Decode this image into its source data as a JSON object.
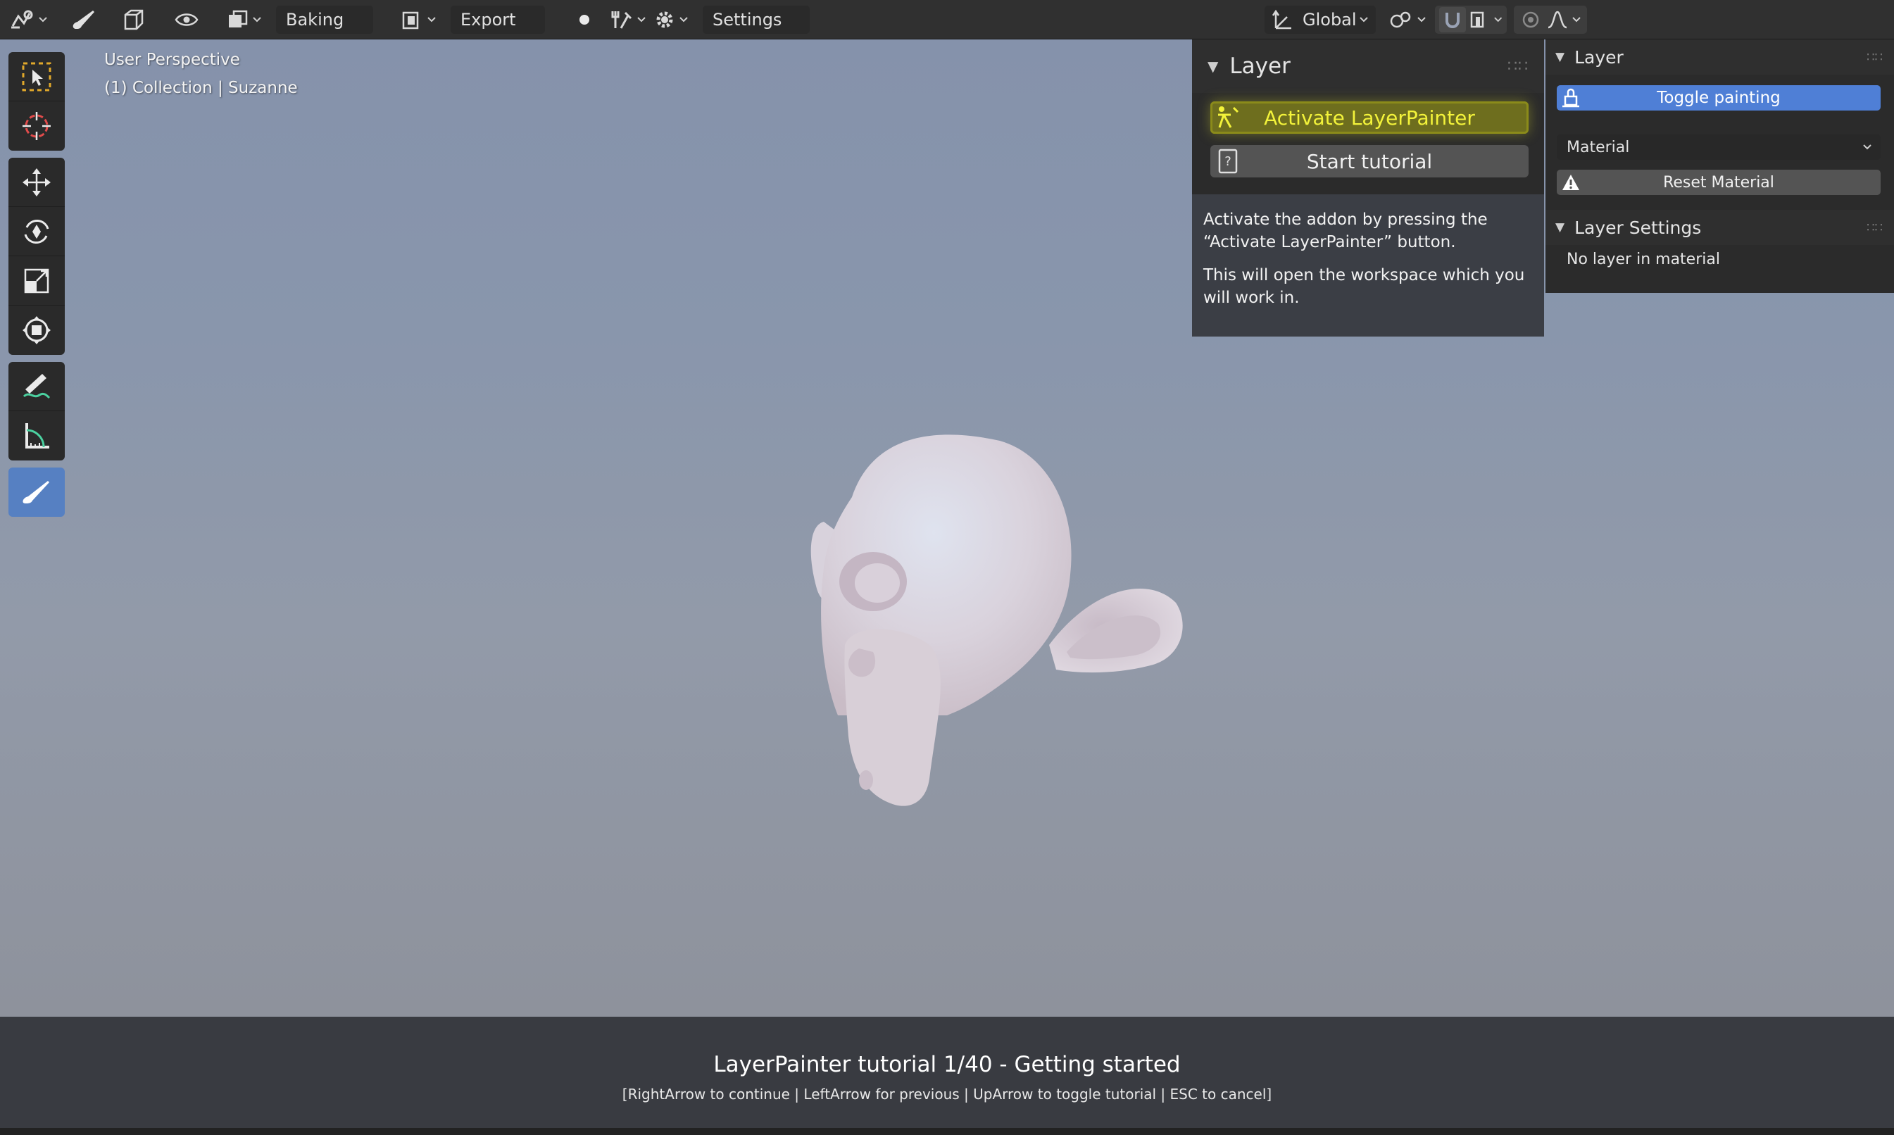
{
  "header": {
    "baking_label": "Baking",
    "export_label": "Export",
    "settings_label": "Settings",
    "transform_orientation": "Global"
  },
  "viewport": {
    "perspective_label": "User Perspective",
    "collection_label": "(1) Collection | Suzanne"
  },
  "tutorial_panel": {
    "title": "Layer",
    "activate_label": "Activate LayerPainter",
    "tutorial_label": "Start tutorial",
    "desc_p1": "Activate the addon by pressing the “Activate LayerPainter” button.",
    "desc_p2": "This will open the workspace which you will work in.",
    "highlight_color": "#f3f33a"
  },
  "sidebar": {
    "layer_title": "Layer",
    "toggle_label": "Toggle painting",
    "material_value": "Material",
    "reset_label": "Reset Material",
    "settings_title": "Layer Settings",
    "no_layer_text": "No layer in material",
    "accent_color": "#4f7fd6"
  },
  "tutorial_bar": {
    "title": "LayerPainter tutorial 1/40 - Getting started",
    "hint": "[RightArrow to continue | LeftArrow for previous | UpArrow to toggle tutorial | ESC to cancel]"
  }
}
